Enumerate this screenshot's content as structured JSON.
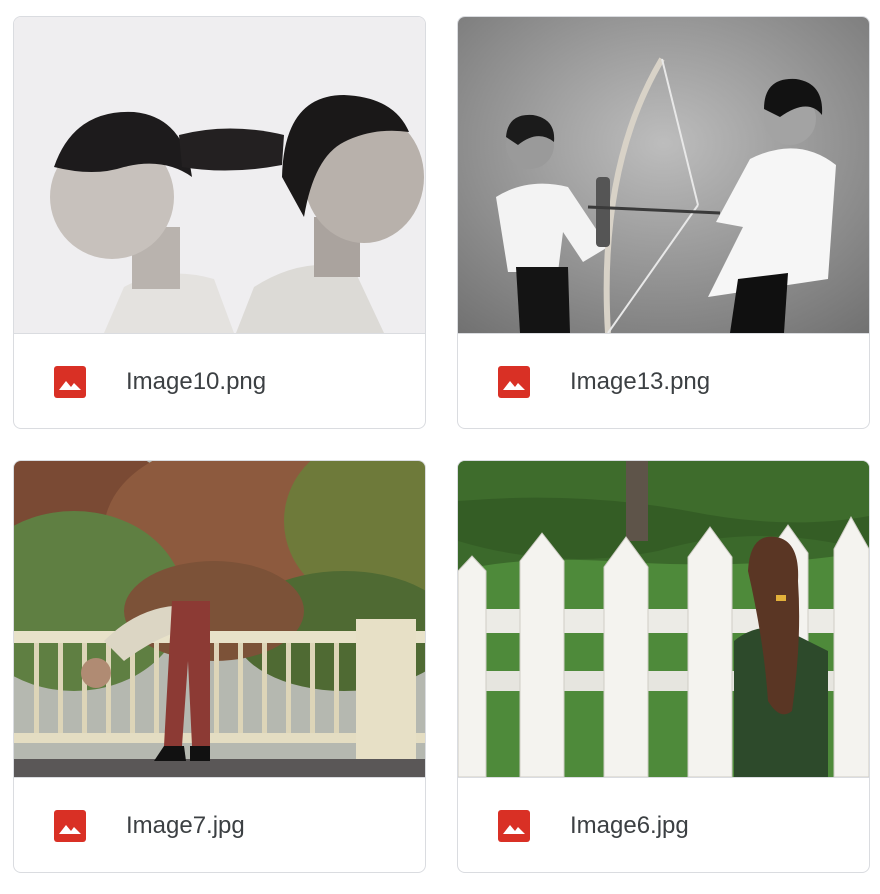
{
  "files": [
    {
      "name": "Image10.png",
      "icon": "image-file-icon",
      "thumbnail": "photo-two-people-hair-tied"
    },
    {
      "name": "Image13.png",
      "icon": "image-file-icon",
      "thumbnail": "photo-two-people-bow-arrow"
    },
    {
      "name": "Image7.jpg",
      "icon": "image-file-icon",
      "thumbnail": "photo-person-bending-over-railing"
    },
    {
      "name": "Image6.jpg",
      "icon": "image-file-icon",
      "thumbnail": "photo-person-behind-picket-fence"
    }
  ],
  "colors": {
    "icon_red": "#d93025",
    "border": "#dadce0",
    "text": "#3c4043"
  }
}
